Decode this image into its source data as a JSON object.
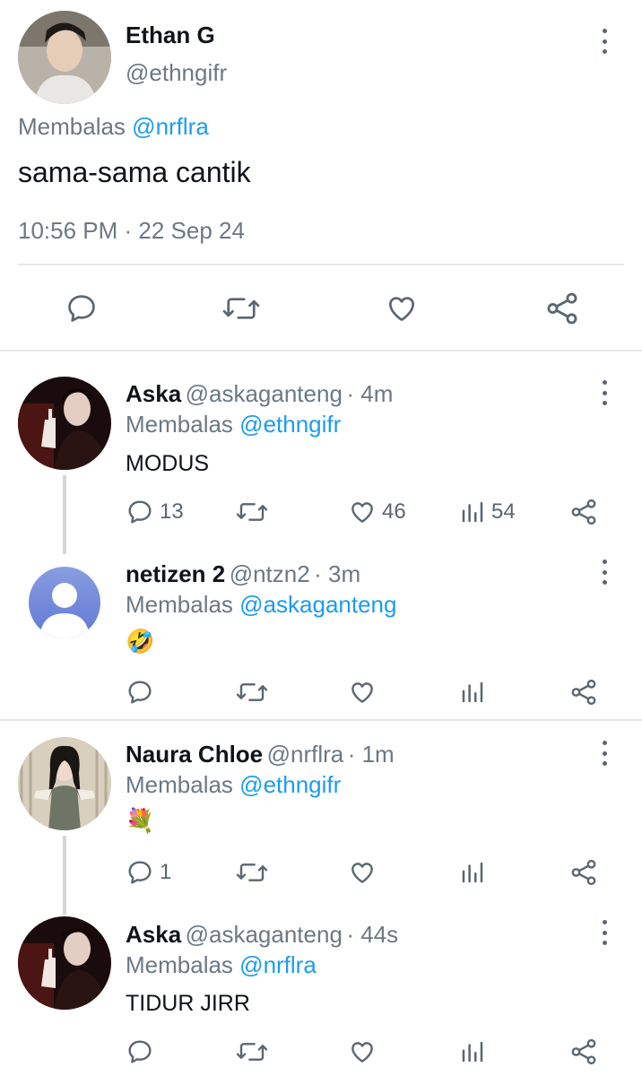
{
  "main_tweet": {
    "name": "Ethan G",
    "handle": "@ethngifr",
    "reply_prefix": "Membalas",
    "reply_to": "@nrflra",
    "text": "sama-sama cantik",
    "timestamp": "10:56 PM · 22 Sep 24"
  },
  "icons": {
    "reply": "speech-bubble-icon",
    "retweet": "retweet-icon",
    "like": "heart-icon",
    "views": "bar-chart-icon",
    "share": "share-icon",
    "more": "more-vertical-icon"
  },
  "replies": [
    {
      "name": "Aska",
      "handle": "@askaganteng",
      "time": "· 4m",
      "reply_prefix": "Membalas",
      "reply_to": "@ethngifr",
      "text": "MODUS",
      "reply_count": "13",
      "like_count": "46",
      "view_count": "54"
    },
    {
      "name": "netizen 2",
      "handle": "@ntzn2",
      "time": "· 3m",
      "reply_prefix": "Membalas",
      "reply_to": "@askaganteng",
      "text": "🤣"
    },
    {
      "name": "Naura Chloe",
      "handle": "@nrflra",
      "time": "· 1m",
      "reply_prefix": "Membalas",
      "reply_to": "@ethngifr",
      "text": "💐",
      "reply_count": "1"
    },
    {
      "name": "Aska",
      "handle": "@askaganteng",
      "time": "· 44s",
      "reply_prefix": "Membalas",
      "reply_to": "@nrflra",
      "text": "TIDUR JIRR"
    }
  ]
}
